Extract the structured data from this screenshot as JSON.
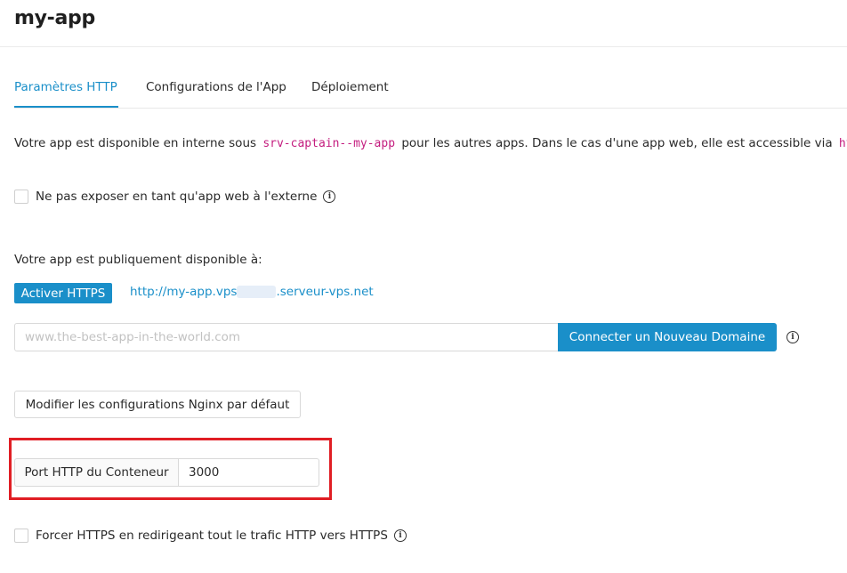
{
  "app": {
    "title": "my-app"
  },
  "tabs": [
    {
      "label": "Paramètres HTTP",
      "active": true
    },
    {
      "label": "Configurations de l'App",
      "active": false
    },
    {
      "label": "Déploiement",
      "active": false
    }
  ],
  "internal_info": {
    "prefix": "Votre app est disponible en interne sous",
    "service_name": "srv-captain--my-app",
    "suffix": "pour les autres apps. Dans le cas d'une app web, elle est accessible via",
    "url_start": "htt"
  },
  "no_expose": {
    "label": "Ne pas exposer en tant qu'app web à l'externe",
    "checked": false,
    "icon": "info-icon"
  },
  "public": {
    "label": "Votre app est publiquement disponible à:",
    "https_button": "Activer HTTPS",
    "url_part1": "http://my-app.vps",
    "url_part2": ".serveur-vps.net"
  },
  "domain": {
    "placeholder": "www.the-best-app-in-the-world.com",
    "value": "",
    "connect_button": "Connecter un Nouveau Domaine",
    "icon": "info-icon"
  },
  "nginx": {
    "button": "Modifier les configurations Nginx par défaut"
  },
  "port": {
    "label": "Port HTTP du Conteneur",
    "value": "3000"
  },
  "force_https": {
    "label": "Forcer HTTPS en redirigeant tout le trafic HTTP vers HTTPS",
    "checked": false,
    "icon": "info-icon"
  },
  "colors": {
    "accent": "#1a8fc9",
    "highlight": "#e01e24",
    "code": "#c41d7f"
  }
}
